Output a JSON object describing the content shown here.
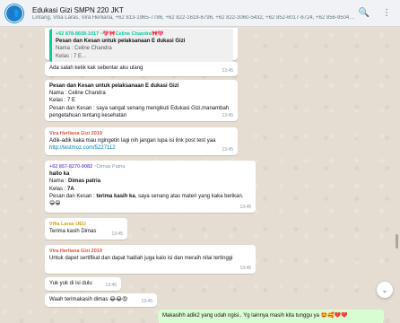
{
  "header": {
    "title": "Edukasi Gizi SMPN 220 JKT",
    "members": "Lintang, Vifia Laras, Vira Herliana, +62 813-1965-7786, +62 822-1618-6796, +62 822-3060-5432, +62 852-6017-6724, +62 856-9504-6...",
    "search_icon": "🔍",
    "menu_icon": "⋮"
  },
  "messages": {
    "m1": {
      "quote_author": "+62 878-8608-1017 ~💖🎀Celine Chandra🎀💖",
      "quote_title": "Pesan dan Kesan untuk pelaksanaan E dukasi Gizi",
      "quote_line1": "Nama   : Celine Chandra",
      "quote_line2": "Kelas   : 7 E..."
    },
    "m2": {
      "text": "Ada salah ketik kak sebentar aku ulang",
      "time": "13:45"
    },
    "m3": {
      "title": "Pesan dan Kesan untuk pelaksanaan E dukasi Gizi",
      "line1": "Nama   : Celine Chandra",
      "line2": "Kelas   : 7 E",
      "line3": "Pesan dan Kesan : saya sangat senang mengikuti Edukasi Gizi,manambah",
      "line4": "pengetahuan tentang kesehatan",
      "time": "13:45"
    },
    "m4": {
      "sender": "Vira Herliana Gizi 2019",
      "text": "Adik-adik kaka mau ngingetin lagi nih jangan lupa isi link post test yaa",
      "link": "http://testmoz.com/5227112",
      "time": "13:45"
    },
    "m5": {
      "sender": "+62 857-8270-9082",
      "sender_name": "~Dimas Patria",
      "greeting": "hallo ka",
      "name_label": "Nama   : ",
      "name_value": "Dimas patria",
      "class_label": "Kelas   : ",
      "class_value": "7A",
      "msg_label": "Pesan dan Kesan : ",
      "msg_bold": "terima kasih ka",
      "msg_rest": ", saya senang atas materi yang kaka berikan.",
      "emoji": "😁😁",
      "time": "13:45"
    },
    "m6": {
      "sender": "Vifia Laras UEU",
      "text": "Terima kasih Dimas",
      "time": "13:45"
    },
    "m7": {
      "sender": "Vira Herliana Gizi 2019",
      "text": "Untuk dapet sertifikat dan dapat hadiah juga kalo isi dan meraih nilai tertinggi",
      "time": "13:45"
    },
    "m8": {
      "text": "Yuk yuk di isi dulu",
      "time": "13:45"
    },
    "m9": {
      "text": "Waah terimakasih dimas 😂😂😍",
      "time": "13:45"
    },
    "m10": {
      "text": "Makasihh adik2 yang udah ngisi.. Yg lainnya masih kita tunggu ya 🤩🥰❤️❤️",
      "time": ""
    }
  },
  "colors": {
    "header_bg": "#f0f2f5",
    "chat_bg": "#e5ddd2",
    "outgoing_bubble": "#d9fdd3",
    "sender_red": "#e0523a",
    "sender_orange": "#d99a12",
    "sender_purple": "#8b5bd6",
    "link": "#027eb5"
  }
}
